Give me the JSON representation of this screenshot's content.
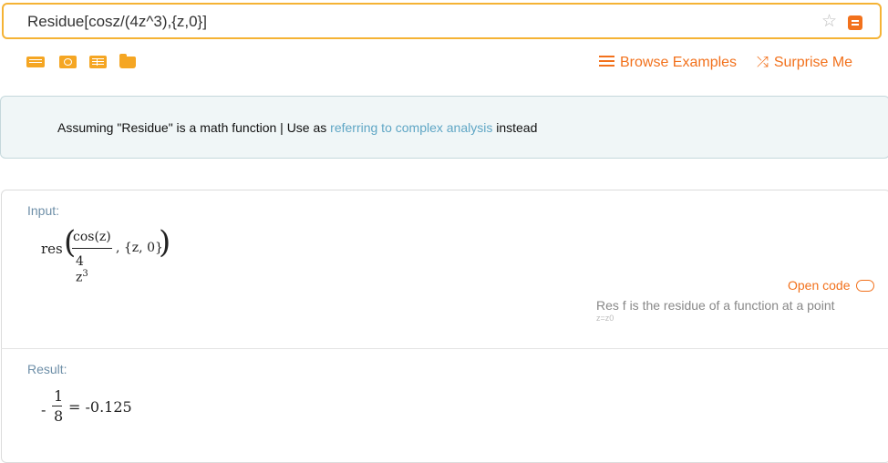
{
  "search": {
    "value": "Residue[cosz/(4z^3),{z,0}]"
  },
  "toolbar": {
    "icons": [
      "keyboard-icon",
      "camera-icon",
      "table-icon",
      "folder-upload-icon"
    ],
    "browse_label": "Browse Examples",
    "surprise_label": "Surprise Me"
  },
  "assumption": {
    "prefix": "Assuming \"Residue\" is a math function | Use as ",
    "link": "referring to complex analysis",
    "suffix": " instead"
  },
  "input_pod": {
    "title": "Input:",
    "func": "res",
    "numerator": "cos(z)",
    "denominator": "4 z",
    "exponent": "3",
    "args": ", {z, 0}",
    "open_code": "Open code",
    "hint_text": "Res f is the residue of a function at a point",
    "hint_sub": "z=z0"
  },
  "result_pod": {
    "title": "Result:",
    "sign": "-",
    "numerator": "1",
    "denominator": "8",
    "equals": "= -0.125"
  },
  "colors": {
    "accent": "#f2711c",
    "search_border": "#f5b335",
    "link": "#5fa6c5",
    "pod_title": "#6e8fa8"
  }
}
